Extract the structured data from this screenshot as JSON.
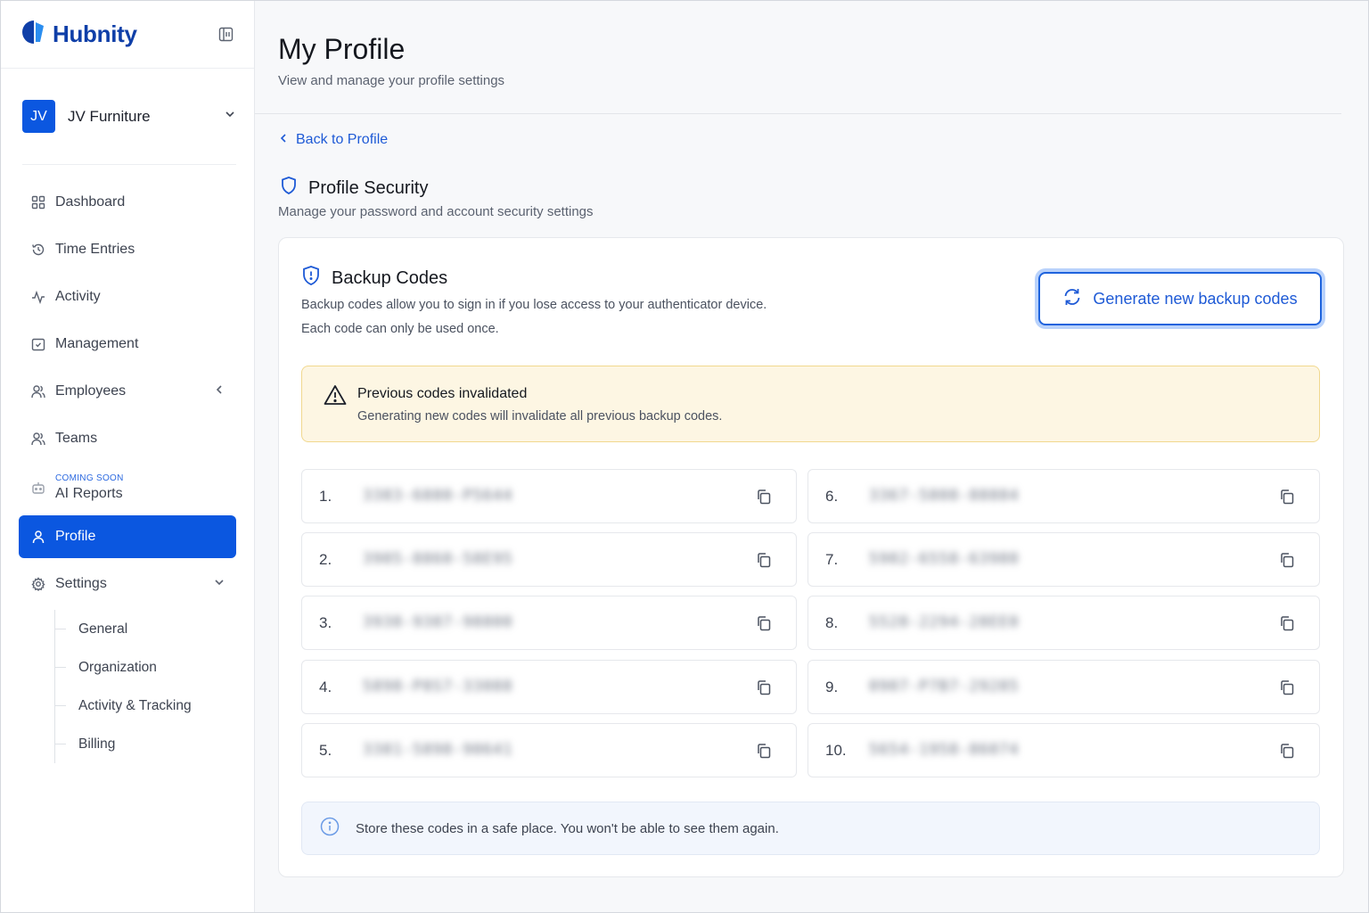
{
  "brand": {
    "name": "Hubnity",
    "accent": "#0b57e0"
  },
  "org": {
    "initials": "JV",
    "name": "JV Furniture"
  },
  "nav": {
    "items": [
      {
        "label": "Dashboard",
        "icon": "grid-icon"
      },
      {
        "label": "Time Entries",
        "icon": "history-icon"
      },
      {
        "label": "Activity",
        "icon": "activity-icon"
      },
      {
        "label": "Management",
        "icon": "calendar-check-icon"
      },
      {
        "label": "Employees",
        "icon": "users-icon"
      },
      {
        "label": "Teams",
        "icon": "users-icon"
      }
    ],
    "ai": {
      "badge": "COMING SOON",
      "label": "AI Reports"
    },
    "profile": "Profile",
    "settings": "Settings",
    "settings_sub": [
      "General",
      "Organization",
      "Activity & Tracking",
      "Billing"
    ]
  },
  "header": {
    "title": "My Profile",
    "subtitle": "View and manage your profile settings"
  },
  "back_link": "Back to Profile",
  "section": {
    "title": "Profile Security",
    "subtitle": "Manage your password and account security settings"
  },
  "backup": {
    "title": "Backup Codes",
    "desc1": "Backup codes allow you to sign in if you lose access to your authenticator device.",
    "desc2": "Each code can only be used once.",
    "generate_label": "Generate new backup codes",
    "warning_title": "Previous codes invalidated",
    "warning_text": "Generating new codes will invalidate all previous backup codes.",
    "codes": [
      {
        "num": "1.",
        "value": "3383-6880-P5644"
      },
      {
        "num": "2.",
        "value": "3905-8860-58E95"
      },
      {
        "num": "3.",
        "value": "3938-9387-98800"
      },
      {
        "num": "4.",
        "value": "5898-P8S7-33088"
      },
      {
        "num": "5.",
        "value": "3381-5898-90641"
      },
      {
        "num": "6.",
        "value": "3367-5808-88884"
      },
      {
        "num": "7.",
        "value": "5902-6558-63980"
      },
      {
        "num": "8.",
        "value": "5528-2294-28EE0"
      },
      {
        "num": "9.",
        "value": "0907-P7B7-29285"
      },
      {
        "num": "10.",
        "value": "5654-1958-86074"
      }
    ],
    "info_text": "Store these codes in a safe place. You won't be able to see them again."
  }
}
